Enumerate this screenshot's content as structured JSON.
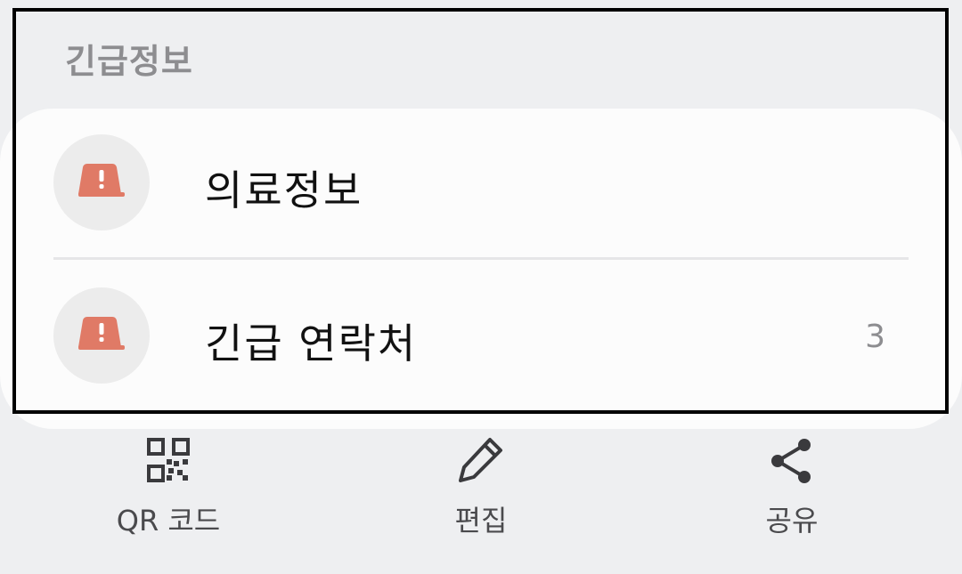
{
  "section": {
    "title": "긴급정보"
  },
  "items": [
    {
      "label": "의료정보",
      "count": "",
      "icon": "alert-siren-icon"
    },
    {
      "label": "긴급 연락처",
      "count": "3",
      "icon": "alert-siren-icon"
    }
  ],
  "actions": {
    "qr": {
      "label": "QR 코드",
      "icon": "qr-code-icon"
    },
    "edit": {
      "label": "편집",
      "icon": "pencil-icon"
    },
    "share": {
      "label": "공유",
      "icon": "share-icon"
    }
  },
  "colors": {
    "background": "#eeeff1",
    "card": "#fcfcfc",
    "icon_bg": "#ececec",
    "icon_accent": "#e07a66",
    "muted_text": "#8d8d90",
    "highlight_border": "#000000"
  }
}
